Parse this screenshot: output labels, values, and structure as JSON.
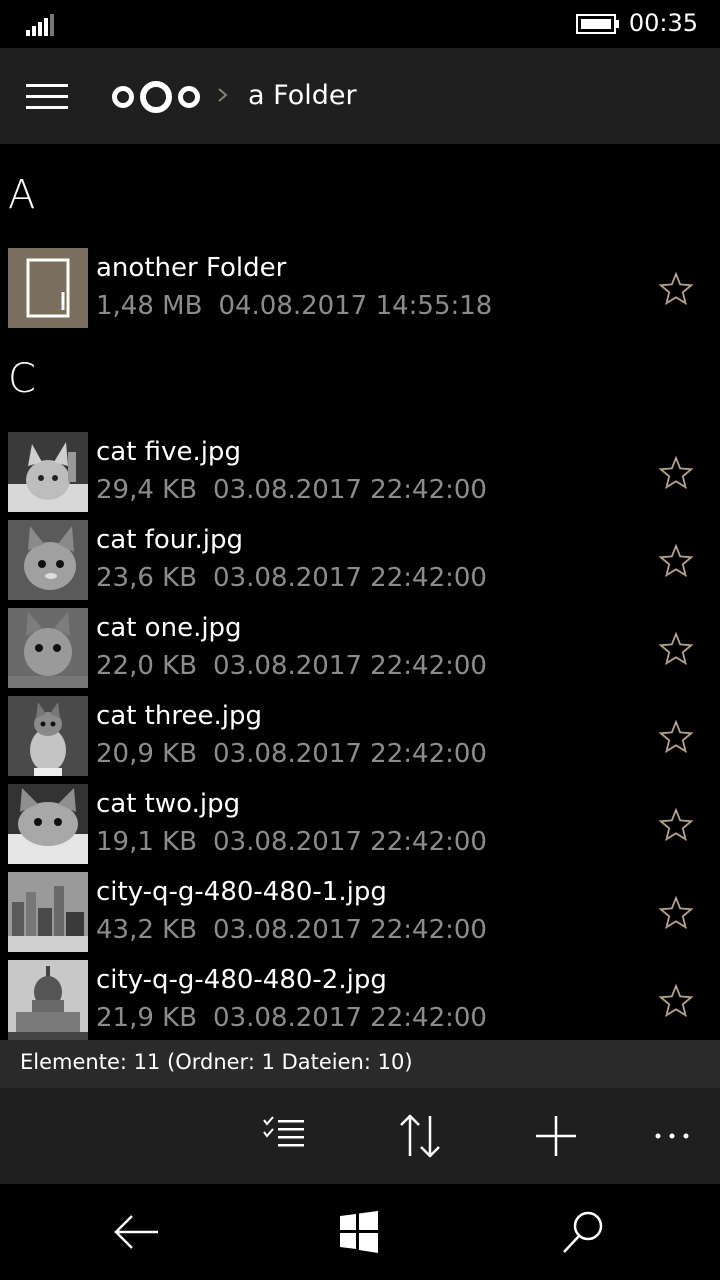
{
  "status_bar": {
    "time": "00:35",
    "signal_icon": "signal-bars-icon",
    "battery_icon": "battery-icon"
  },
  "header": {
    "menu_icon": "hamburger-menu-icon",
    "logo_icon": "nextcloud-logo-icon",
    "breadcrumb_separator_icon": "chevron-right-icon",
    "title": "a Folder"
  },
  "groups": [
    {
      "letter": "A",
      "items": [
        {
          "name": "another Folder",
          "size": "1,48 MB",
          "date": "04.08.2017 14:55:18",
          "kind": "folder"
        }
      ]
    },
    {
      "letter": "C",
      "items": [
        {
          "name": "cat five.jpg",
          "size": "29,4 KB",
          "date": "03.08.2017 22:42:00",
          "kind": "cat"
        },
        {
          "name": "cat four.jpg",
          "size": "23,6 KB",
          "date": "03.08.2017 22:42:00",
          "kind": "cat"
        },
        {
          "name": "cat one.jpg",
          "size": "22,0 KB",
          "date": "03.08.2017 22:42:00",
          "kind": "cat"
        },
        {
          "name": "cat three.jpg",
          "size": "20,9 KB",
          "date": "03.08.2017 22:42:00",
          "kind": "cat"
        },
        {
          "name": "cat two.jpg",
          "size": "19,1 KB",
          "date": "03.08.2017 22:42:00",
          "kind": "cat"
        },
        {
          "name": "city-q-g-480-480-1.jpg",
          "size": "43,2 KB",
          "date": "03.08.2017 22:42:00",
          "kind": "city"
        },
        {
          "name": "city-q-g-480-480-2.jpg",
          "size": "21,9 KB",
          "date": "03.08.2017 22:42:00",
          "kind": "dome"
        }
      ]
    }
  ],
  "summary": "Elemente: 11 (Ordner: 1 Dateien: 10)",
  "app_bar": {
    "icons": [
      "select-list-icon",
      "sort-icon",
      "add-icon",
      "more-icon"
    ]
  },
  "nav_bar": {
    "icons": [
      "back-arrow-icon",
      "windows-start-icon",
      "search-icon"
    ]
  },
  "colors": {
    "header_bg": "#1f1f1f",
    "summary_bg": "#2a2a2a",
    "folder_thumb": "#7a6f5e",
    "star_outline": "#b3a48c",
    "meta_text": "#8c8c8c"
  }
}
